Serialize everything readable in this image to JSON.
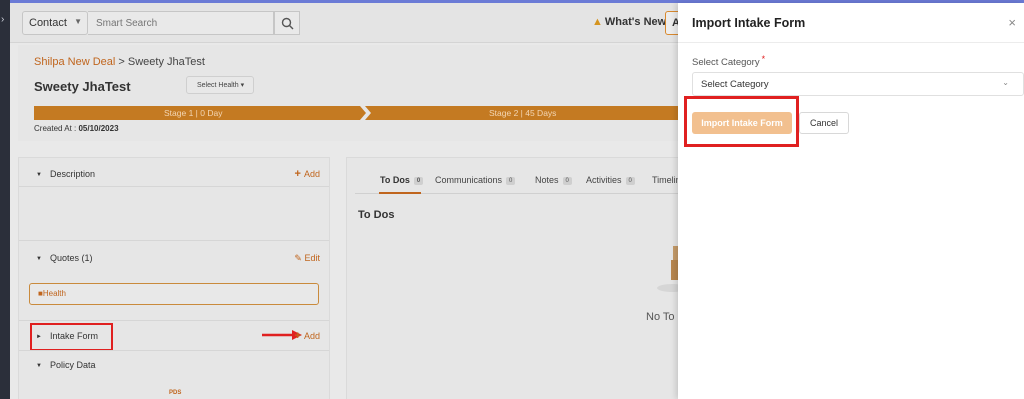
{
  "header": {
    "contact_label": "Contact",
    "search_placeholder": "Smart Search",
    "whats_new": "What's New",
    "add_partial": "A"
  },
  "deal": {
    "breadcrumb_parent": "Shilpa New Deal",
    "breadcrumb_sep": ">",
    "breadcrumb_current": "Sweety JhaTest",
    "title": "Sweety JhaTest",
    "health_select": "Select Health",
    "stages": [
      "Stage 1 | 0 Day",
      "Stage 2 | 45 Days"
    ],
    "created_label": "Created At :",
    "created_date": "05/10/2023"
  },
  "left_panel": {
    "description": {
      "label": "Description",
      "action": "Add"
    },
    "quotes": {
      "label": "Quotes (1)",
      "action": "Edit"
    },
    "health_item": "Health",
    "intake_form": {
      "label": "Intake Form",
      "action": "Add"
    },
    "policy_data": {
      "label": "Policy Data"
    },
    "policy_logo": "PDS"
  },
  "right_panel": {
    "tabs": [
      {
        "label": "To Dos",
        "count": "0"
      },
      {
        "label": "Communications",
        "count": "0"
      },
      {
        "label": "Notes",
        "count": "0"
      },
      {
        "label": "Activities",
        "count": "0"
      },
      {
        "label": "Timeline",
        "count": ""
      }
    ],
    "section_title": "To Dos",
    "empty_text": "No To D"
  },
  "drawer": {
    "title": "Import Intake Form",
    "close": "×",
    "category_label": "Select Category",
    "required_mark": "*",
    "category_value": "Select Category",
    "import_button": "Import Intake Form",
    "cancel_button": "Cancel"
  },
  "colors": {
    "accent": "#c0651d",
    "highlight": "#e02020",
    "import_button_bg": "#f2c08f"
  }
}
